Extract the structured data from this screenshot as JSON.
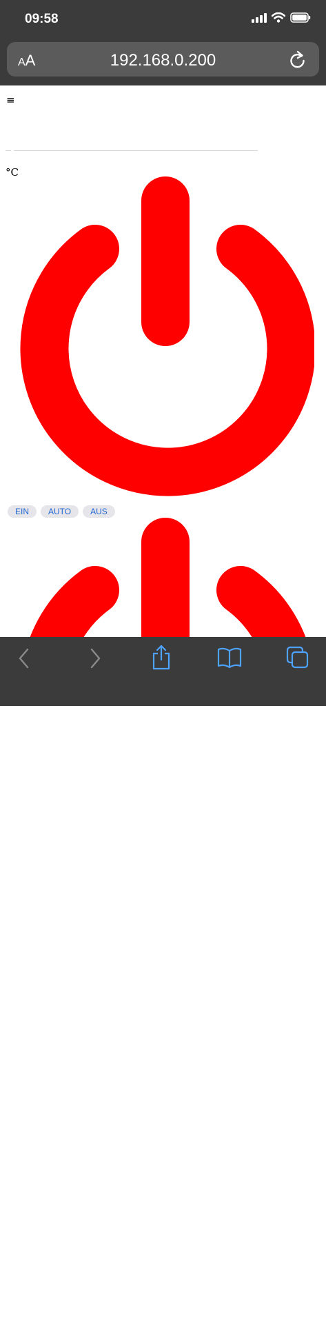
{
  "status_bar": {
    "time": "09:58",
    "icons": [
      "signal-icon",
      "wifi-icon",
      "battery-icon"
    ]
  },
  "address_bar": {
    "text_size_label": "AA",
    "url": "192.168.0.200",
    "reload_icon": "reload-icon"
  },
  "page": {
    "menu_icon": "≡",
    "temperature_unit": "°C",
    "power_icon_color": "#ff0000",
    "mode_buttons": [
      {
        "label": "EIN"
      },
      {
        "label": "AUTO"
      },
      {
        "label": "AUS"
      }
    ]
  },
  "toolbar": {
    "icons": [
      "back-icon",
      "forward-icon",
      "share-icon",
      "bookmarks-icon",
      "tabs-icon"
    ]
  }
}
